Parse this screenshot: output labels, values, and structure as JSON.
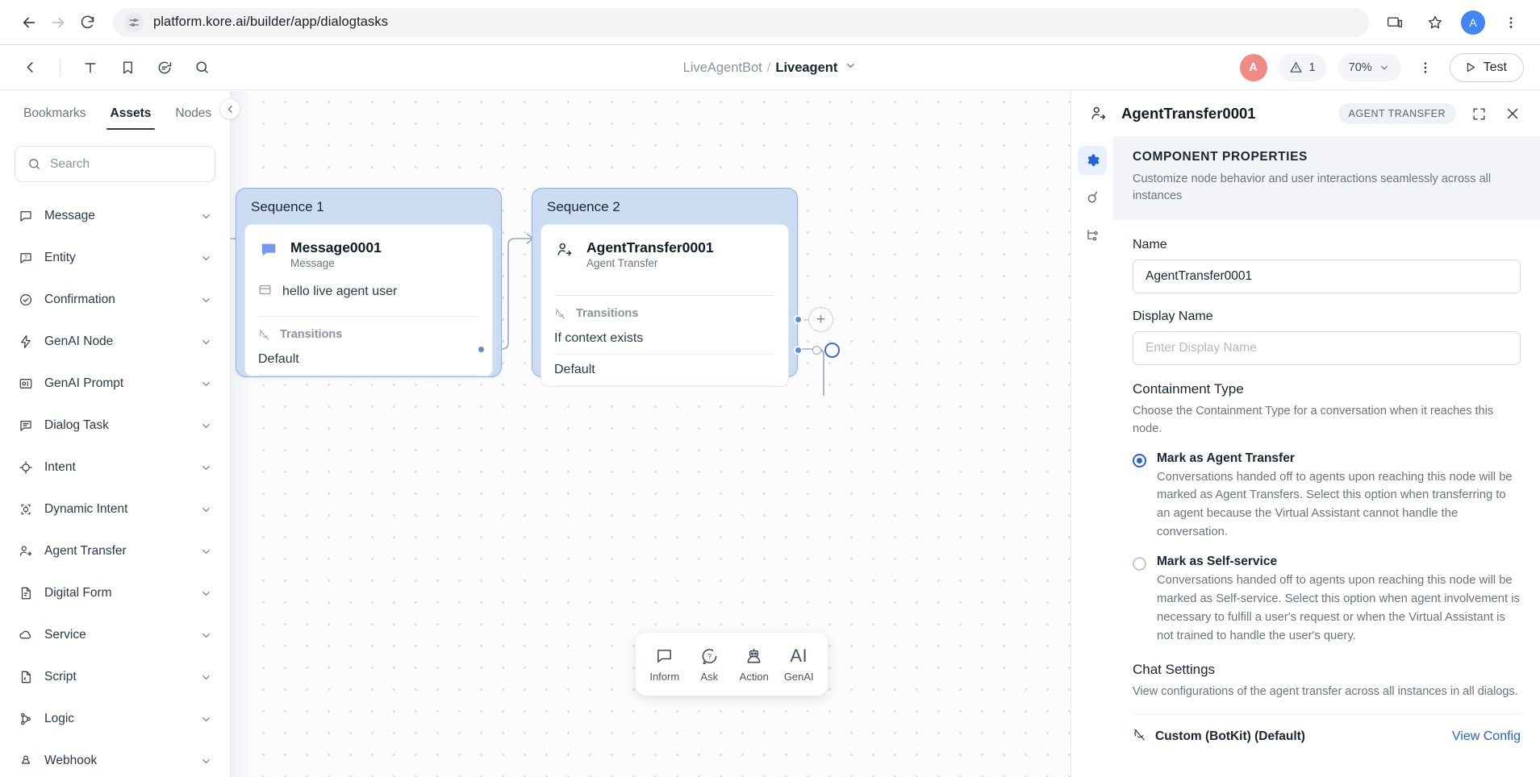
{
  "browser": {
    "url": "platform.kore.ai/builder/app/dialogtasks",
    "avatar_initial": "A",
    "icons": {
      "back": "back-arrow-icon",
      "forward": "forward-arrow-icon",
      "reload": "reload-icon",
      "site_info": "site-settings-icon",
      "install": "install-app-icon",
      "bookmark": "star-icon",
      "menu": "kebab-menu-icon"
    }
  },
  "header": {
    "back_label": "back",
    "breadcrumb": {
      "root": "LiveAgentBot",
      "separator": "/",
      "current": "Liveagent"
    },
    "avatar_initial": "A",
    "warning_count": "1",
    "zoom_level": "70%",
    "test_label": "Test",
    "tools": [
      {
        "name": "text-tool-icon",
        "glyph": "T"
      },
      {
        "name": "bookmark-icon"
      },
      {
        "name": "comment-icon"
      },
      {
        "name": "search-icon"
      }
    ]
  },
  "sidebar": {
    "tabs": [
      {
        "label": "Bookmarks",
        "active": false
      },
      {
        "label": "Assets",
        "active": true
      },
      {
        "label": "Nodes",
        "active": false
      }
    ],
    "search_placeholder": "Search",
    "items": [
      {
        "label": "Message",
        "icon": "message-icon"
      },
      {
        "label": "Entity",
        "icon": "entity-icon"
      },
      {
        "label": "Confirmation",
        "icon": "confirmation-icon"
      },
      {
        "label": "GenAI Node",
        "icon": "genai-node-icon"
      },
      {
        "label": "GenAI Prompt",
        "icon": "genai-prompt-icon"
      },
      {
        "label": "Dialog Task",
        "icon": "dialog-task-icon"
      },
      {
        "label": "Intent",
        "icon": "intent-icon"
      },
      {
        "label": "Dynamic Intent",
        "icon": "dynamic-intent-icon"
      },
      {
        "label": "Agent Transfer",
        "icon": "agent-transfer-icon"
      },
      {
        "label": "Digital Form",
        "icon": "digital-form-icon"
      },
      {
        "label": "Service",
        "icon": "service-icon"
      },
      {
        "label": "Script",
        "icon": "script-icon"
      },
      {
        "label": "Logic",
        "icon": "logic-icon"
      },
      {
        "label": "Webhook",
        "icon": "webhook-icon"
      }
    ]
  },
  "canvas": {
    "sequences": [
      {
        "title": "Sequence 1",
        "node_title": "Message0001",
        "node_subtitle": "Message",
        "node_icon": "message-bubble-icon",
        "message_text": "hello live agent user",
        "transitions_label": "Transitions",
        "transitions": [
          "Default"
        ]
      },
      {
        "title": "Sequence 2",
        "node_title": "AgentTransfer0001",
        "node_subtitle": "Agent Transfer",
        "node_icon": "agent-transfer-icon",
        "transitions_label": "Transitions",
        "transitions": [
          "If context exists",
          "Default"
        ]
      }
    ],
    "toolbar": [
      {
        "label": "Inform",
        "icon": "inform-bubble-icon"
      },
      {
        "label": "Ask",
        "icon": "ask-question-icon"
      },
      {
        "label": "Action",
        "icon": "action-robot-icon"
      },
      {
        "label": "GenAI",
        "icon": "genai-text-icon",
        "glyph": "AI"
      }
    ]
  },
  "panel": {
    "title": "AgentTransfer0001",
    "badge": "AGENT TRANSFER",
    "rail": [
      {
        "name": "properties-gear-icon",
        "active": true
      },
      {
        "name": "connections-icon",
        "active": false
      },
      {
        "name": "node-links-icon",
        "active": false
      }
    ],
    "section_title": "COMPONENT PROPERTIES",
    "section_desc": "Customize node behavior and user interactions seamlessly across all instances",
    "name_label": "Name",
    "name_value": "AgentTransfer0001",
    "display_name_label": "Display Name",
    "display_name_placeholder": "Enter Display Name",
    "containment_title": "Containment Type",
    "containment_desc": "Choose the Containment Type for a conversation when it reaches this node.",
    "options": [
      {
        "label": "Mark as Agent Transfer",
        "selected": true,
        "desc": "Conversations handed off to agents upon reaching this node will be marked as Agent Transfers. Select this option when transferring to an agent because the Virtual Assistant cannot handle the conversation."
      },
      {
        "label": "Mark as Self-service",
        "selected": false,
        "desc": "Conversations handed off to agents upon reaching this node will be marked as Self-service. Select this option when agent involvement is necessary to fulfill a user's request or when the Virtual Assistant is not trained to handle the user's query."
      }
    ],
    "chat_title": "Chat Settings",
    "chat_desc": "View configurations of the agent transfer across all instances in all dialogs.",
    "chat_item_label": "Custom (BotKit) (Default)",
    "chat_item_icon": "plug-icon",
    "view_config_label": "View Config"
  },
  "colors": {
    "accent": "#2563d9",
    "sequence_fill": "#ccdcf2",
    "sequence_border": "#8fb2e0",
    "avatar_app": "#f08a84",
    "link": "#2563d9"
  }
}
